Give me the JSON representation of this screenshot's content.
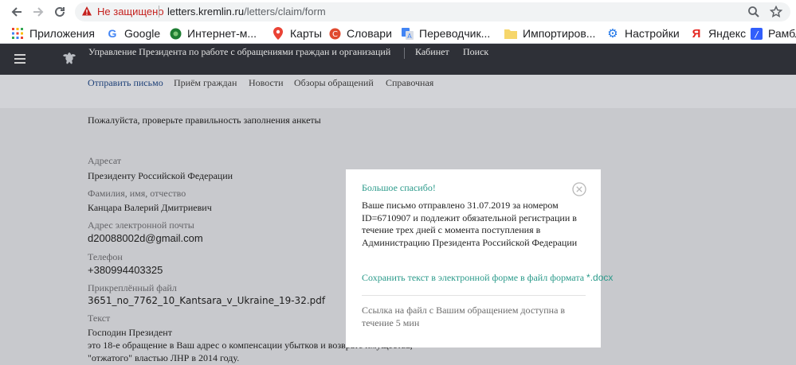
{
  "browser": {
    "security_label": "Не защищено",
    "url_host": "letters.kremlin.ru",
    "url_path": "/letters/claim/form",
    "icons": [
      "back-arrow-icon",
      "forward-arrow-icon",
      "reload-icon",
      "warning-icon",
      "zoom-icon",
      "star-icon"
    ],
    "bookmarks": [
      {
        "label": "Приложения",
        "icon": "apps-grid-icon"
      },
      {
        "label": "Google",
        "icon": "google-icon"
      },
      {
        "label": "Интернет-м...",
        "icon": "green-circle-icon"
      },
      {
        "label": "Карты",
        "icon": "map-pin-icon"
      },
      {
        "label": "Словари",
        "icon": "dictionary-icon"
      },
      {
        "label": "Переводчик...",
        "icon": "translate-icon"
      },
      {
        "label": "Импортиров...",
        "icon": "folder-icon"
      },
      {
        "label": "Настройки",
        "icon": "gear-icon"
      },
      {
        "label": "Яндекс",
        "icon": "yandex-icon"
      },
      {
        "label": "Рамбл",
        "icon": "rambler-icon"
      }
    ]
  },
  "site": {
    "title": "Управление Президента по работе с обращениями граждан и организаций",
    "cabinet": "Кабинет",
    "search": "Поиск",
    "nav": [
      "Отправить письмо",
      "Приём граждан",
      "Новости",
      "Обзоры обращений",
      "Справочная"
    ]
  },
  "form": {
    "heading": "Пожалуйста, проверьте правильность заполнения анкеты",
    "addressee_label": "Адресат",
    "addressee_value": "Президенту Российской Федерации",
    "name_label": "Фамилия, имя, отчество",
    "name_value": "Канцара Валерий Дмитриевич",
    "email_label": "Адрес электронной почты",
    "email_value": "d20088002d@gmail.com",
    "phone_label": "Телефон",
    "phone_value": "+380994403325",
    "file_label": "Прикреплённый файл",
    "file_value": "3651_no_7762_10_Kantsara_v_Ukraine_19-32.pdf",
    "text_label": "Текст",
    "text_line1": "Господин Президент",
    "text_line2": "это 18-е обращение в Ваш адрес о компенсации убытков и возврате имущества,",
    "text_line3": "\"отжатого\" властью ЛНР в 2014 году."
  },
  "modal": {
    "title": "Большое спасибо!",
    "message": "Ваше письмо отправлено 31.07.2019 за номером ID=6710907 и подлежит обязательной регистрации в течение трех дней с момента поступления в Администрацию Президента Российской Федерации",
    "save_link": "Сохранить текст в электронной форме в файл формата",
    "save_ext": "*.docx",
    "note": "Ссылка на файл с Вашим обращением доступна в течение 5 мин"
  },
  "colors": {
    "header_bg": "#2e3037",
    "accent_teal": "#2a9a8a",
    "nav_active": "#1c3f77",
    "insecure_red": "#c5221f"
  }
}
